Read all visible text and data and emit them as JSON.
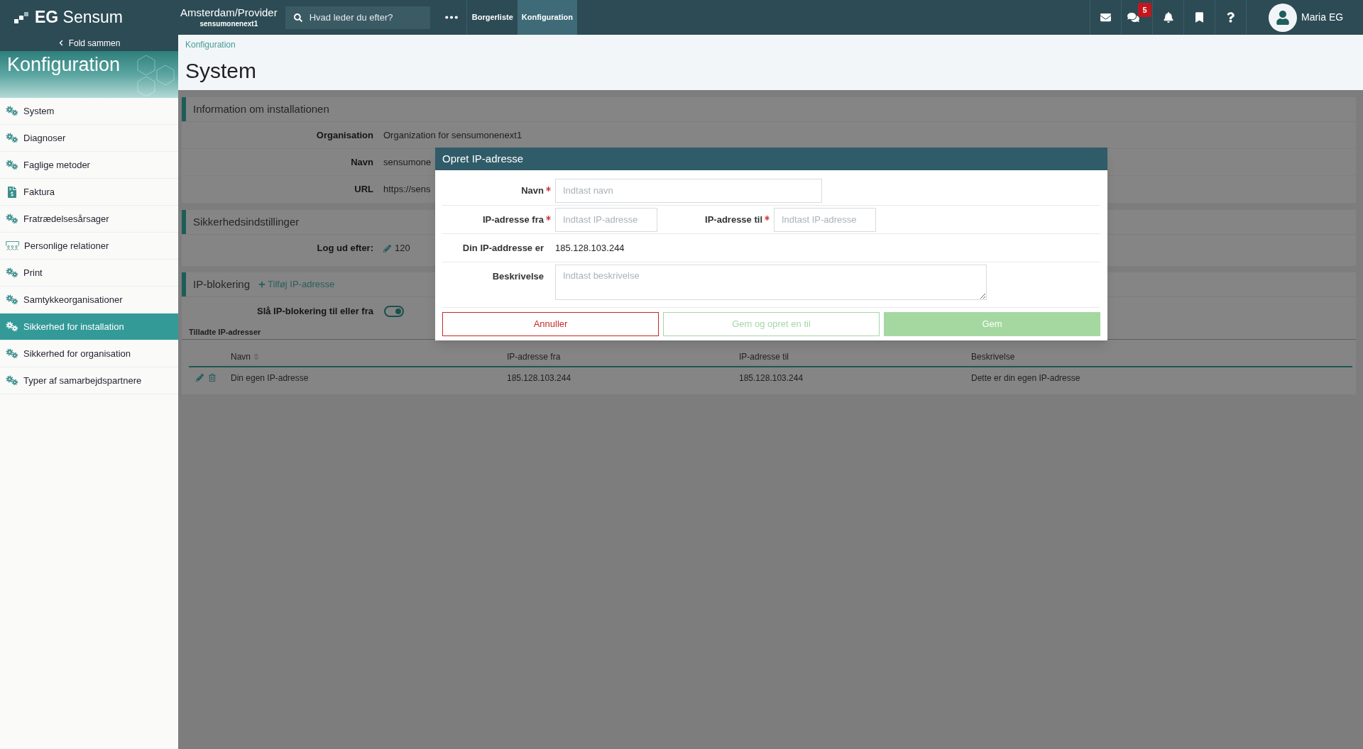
{
  "top_bar": {
    "logo": "**EG** Sensum",
    "context": {
      "title": "Amsterdam/Provider",
      "subtitle": "sensumonenext1"
    },
    "search": {
      "placeholder": "Hvad leder du efter?"
    },
    "nav_tabs": [
      {
        "label": "Borgerliste",
        "selected": false
      },
      {
        "label": "Konfiguration",
        "selected": true
      }
    ],
    "actions": [
      {
        "kind": "mail"
      },
      {
        "kind": "chat",
        "badge": "5"
      },
      {
        "kind": "bell"
      },
      {
        "kind": "bookmark"
      },
      {
        "kind": "help"
      }
    ],
    "user": {
      "name": "Maria EG"
    }
  },
  "sidebar": {
    "collapse_label": "Fold sammen",
    "title": "Konfiguration",
    "items": [
      {
        "label": "System",
        "kind": "gears",
        "selected": false
      },
      {
        "label": "Diagnoser",
        "kind": "gears",
        "selected": false
      },
      {
        "label": "Faglige metoder",
        "kind": "gears",
        "selected": false
      },
      {
        "label": "Faktura",
        "kind": "invoice",
        "selected": false
      },
      {
        "label": "Fratrædelsesårsager",
        "kind": "gears",
        "selected": false
      },
      {
        "label": "Personlige relationer",
        "kind": "people",
        "selected": false
      },
      {
        "label": "Print",
        "kind": "gears",
        "selected": false
      },
      {
        "label": "Samtykkeorganisationer",
        "kind": "gears",
        "selected": false
      },
      {
        "label": "Sikkerhed for installation",
        "kind": "gears",
        "selected": true
      },
      {
        "label": "Sikkerhed for organisation",
        "kind": "gears",
        "selected": false
      },
      {
        "label": "Typer af samarbejdspartnere",
        "kind": "gears",
        "selected": false
      }
    ]
  },
  "page": {
    "breadcrumb": "Konfiguration",
    "title": "System"
  },
  "installation_info": {
    "title": "Information om installationen",
    "fields": [
      {
        "label": "Organisation",
        "value": "Organization for sensumonenext1"
      },
      {
        "label": "Navn",
        "value": "sensumone"
      },
      {
        "label": "URL",
        "value": "https://sens"
      }
    ]
  },
  "security_settings": {
    "title": "Sikkerhedsindstillinger",
    "fields": [
      {
        "label": "Log ud efter:",
        "value": "120"
      }
    ]
  },
  "ip_blocking": {
    "title": "IP-blokering",
    "add_link": "Tilføj IP-adresse",
    "toggle": {
      "label": "Slå IP-blokering til eller fra",
      "on": true
    },
    "table": {
      "caption": "Tilladte IP-adresser",
      "columns": [
        {
          "label": "Navn",
          "sortable": true
        },
        {
          "label": "IP-adresse fra",
          "sortable": false
        },
        {
          "label": "IP-adresse til",
          "sortable": false
        },
        {
          "label": "Beskrivelse",
          "sortable": false
        }
      ],
      "rows": [
        [
          "Din egen IP-adresse",
          "185.128.103.244",
          "185.128.103.244",
          "Dette er din egen IP-adresse"
        ]
      ]
    }
  },
  "dialog": {
    "title": "Opret IP-adresse",
    "rows": [
      {
        "kind": "input",
        "fields": [
          {
            "label": "Navn",
            "placeholder": "Indtast navn",
            "required": true
          }
        ]
      },
      {
        "kind": "pair",
        "fields": [
          {
            "label": "IP-adresse fra",
            "placeholder": "Indtast IP-adresse",
            "required": true
          },
          {
            "label": "IP-adresse til",
            "placeholder": "Indtast IP-adresse",
            "required": true
          }
        ]
      },
      {
        "kind": "text",
        "label": "Din IP-addresse er",
        "value": "185.128.103.244"
      },
      {
        "kind": "textarea",
        "label": "Beskrivelse",
        "placeholder": "Indtast beskrivelse",
        "required": false
      }
    ],
    "buttons": [
      {
        "label": "Annuller",
        "kind": "cancel",
        "disabled": false
      },
      {
        "label": "Gem og opret en til",
        "kind": "secondary",
        "disabled": true
      },
      {
        "label": "Gem",
        "kind": "primary",
        "disabled": true
      }
    ]
  }
}
